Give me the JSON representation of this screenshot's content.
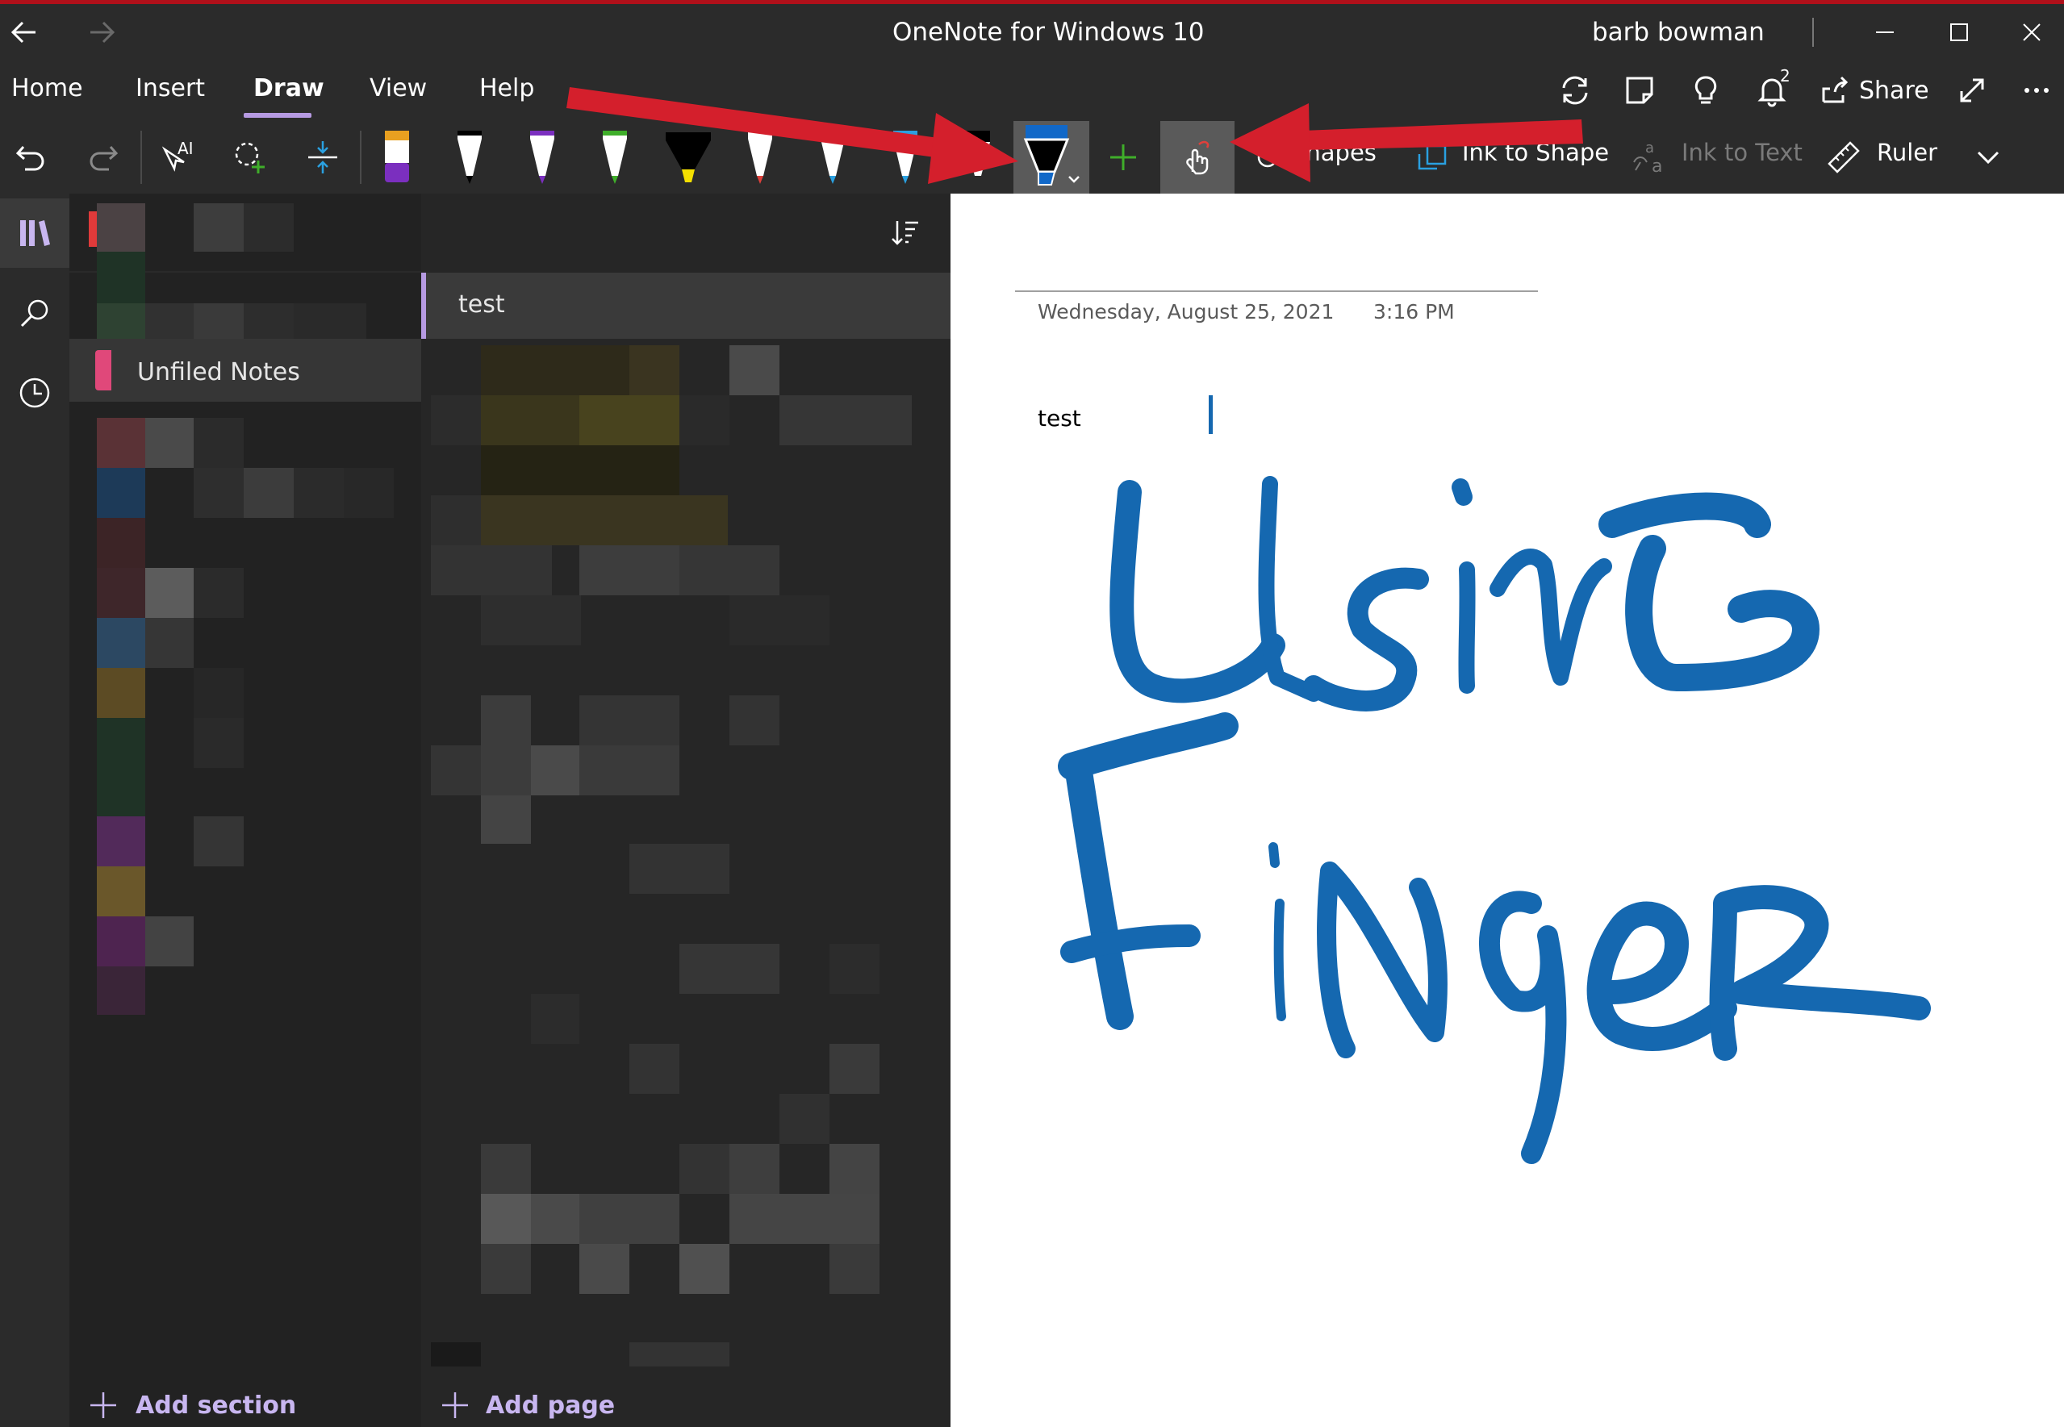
{
  "window": {
    "title": "OneNote for Windows 10",
    "user": "barb bowman"
  },
  "ribbon": {
    "tabs": [
      "Home",
      "Insert",
      "Draw",
      "View",
      "Help"
    ],
    "active_tab": "Draw",
    "share_label": "Share",
    "notification_count": "2"
  },
  "draw_tools": {
    "shapes_label": "Shapes",
    "ink_to_shape_label": "Ink to Shape",
    "ink_to_text_label": "Ink to Text",
    "ruler_label": "Ruler",
    "pen_colors": [
      "#7b2fbf",
      "#000000",
      "#7b2fbf",
      "#3fae2a",
      "#f5e000",
      "#e0403b",
      "#2aa0e0",
      "#2aa0e0",
      "#1168c8"
    ],
    "selected_pen_color": "#1168c8",
    "accent_color": "#b69ae2"
  },
  "sections": {
    "active_section": "Unfiled Notes",
    "add_section_label": "Add section"
  },
  "pages": {
    "active_page": "test",
    "add_page_label": "Add page"
  },
  "note": {
    "date": "Wednesday, August 25, 2021",
    "time": "3:16 PM",
    "body_text": "test",
    "ink_words": [
      "Using",
      "Finger"
    ],
    "ink_color": "#1568b0"
  },
  "annotations": {
    "arrow_color": "#d41f2c"
  }
}
